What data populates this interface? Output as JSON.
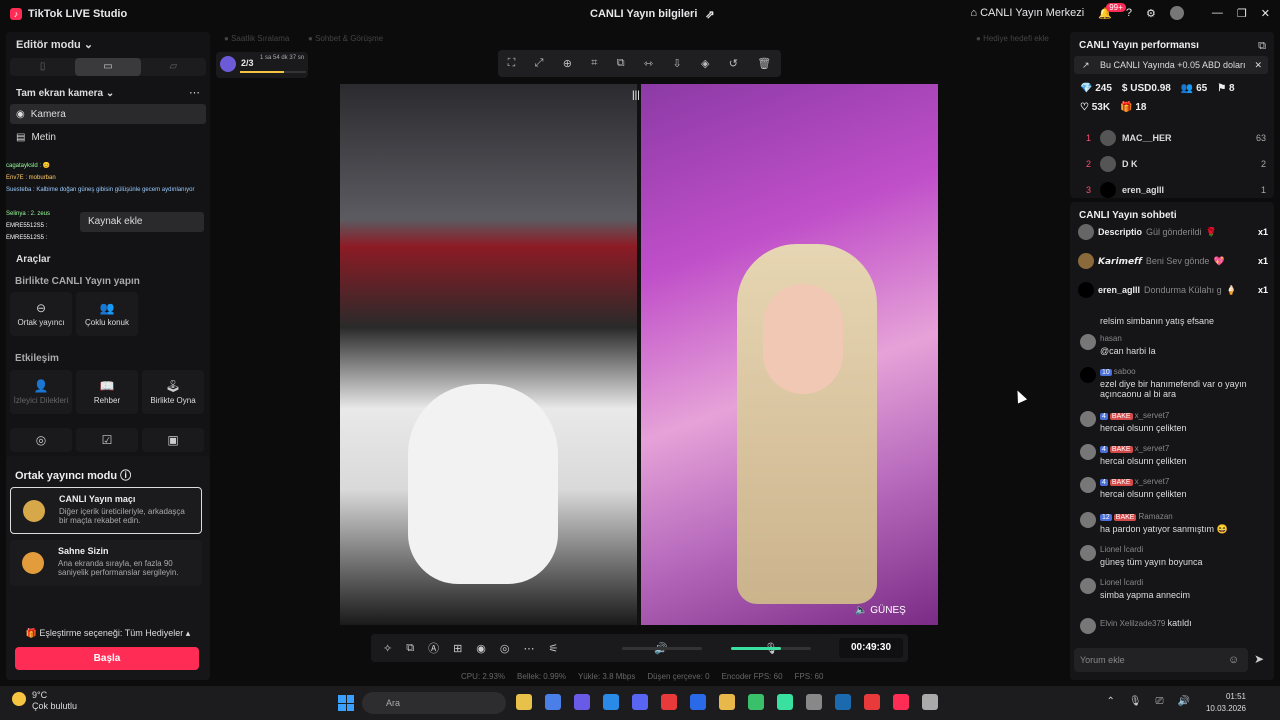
{
  "app": {
    "title": "TikTok LIVE Studio",
    "live_info": "CANLI Yayın bilgileri",
    "live_center": "CANLI Yayın Merkezi",
    "notif_count": "99+"
  },
  "left": {
    "editor_mode": "Editör modu",
    "camera_head": "Tam ekran kamera",
    "sources": [
      {
        "label": "Kamera"
      },
      {
        "label": "Metin"
      }
    ],
    "chat_overlay": [
      "cagatayksld : 😊",
      "Env7E : moburban",
      "Suesteba : Kalbime doğan güneş gibisin gülüşünle gecem aydınlanıyor",
      "Selinya : 2. zeus",
      "EMRE5512S5 :",
      "EMRE5512S5 :"
    ],
    "tooltip": "Kaynak ekle",
    "tools_label": "Araçlar",
    "cohost_head": "Birlikte CANLI Yayın yapın",
    "cohost_btns": [
      {
        "label": "Ortak yayıncı"
      },
      {
        "label": "Çoklu konuk"
      }
    ],
    "interaction_head": "Etkileşim",
    "interaction_btns": [
      {
        "label": "İzleyici Dilekleri"
      },
      {
        "label": "Rehber"
      },
      {
        "label": "Birlikte Oyna"
      }
    ],
    "cohost_mode_head": "Ortak yayıncı modu",
    "cards": [
      {
        "title": "CANLI Yayın maçı",
        "desc": "Diğer içerik üreticileriyle, arkadaşça bir maçta rekabet edin."
      },
      {
        "title": "Sahne Sizin",
        "desc": "Ana ekranda sırayla, en fazla 90 saniyelik performanslar sergileyin."
      }
    ],
    "gift_option": "Eşleştirme seçeneği: Tüm Hediyeler",
    "start": "Başla"
  },
  "canvas": {
    "top_left": "Saatlik Sıralama",
    "top_mid": "Sohbet & Görüşme",
    "top_right": "Hediye hedefi ekle",
    "progress": "2/3",
    "progress_time": "1 sa 54 dk 37 sn",
    "name_tag": "GÜNEŞ"
  },
  "controls": {
    "timer": "00:49:30"
  },
  "stats": {
    "cpu": "CPU: 2.93%",
    "mem": "Bellek: 0.99%",
    "load": "Yükle: 3.8 Mbps",
    "drop": "Düşen çerçeve: 0",
    "enc": "Encoder FPS: 60",
    "fps": "FPS: 60"
  },
  "right": {
    "perf_title": "CANLI Yayın performansı",
    "banner": "Bu CANLI Yayında +0.05 ABD doları",
    "stats": [
      "245",
      "USD0.98",
      "65",
      "8"
    ],
    "stats2": [
      "53K",
      "18"
    ],
    "ranks": [
      {
        "n": "1",
        "name": "MAC__HER",
        "c": "63"
      },
      {
        "n": "2",
        "name": "D K",
        "c": "2"
      },
      {
        "n": "3",
        "name": "eren_aglll",
        "c": "1"
      }
    ],
    "chat_title": "CANLI Yayın sohbeti",
    "gifts": [
      {
        "user": "Descriptio",
        "gift": "Gül gönderildi",
        "x": "x1"
      },
      {
        "user": "𝙆𝙖𝙧𝙞𝙢𝙚𝙛𝙛",
        "gift": "Beni Sev gönde",
        "x": "x1"
      },
      {
        "user": "eren_aglll",
        "gift": "Dondurma Külahı g",
        "x": "x1"
      }
    ],
    "messages": [
      {
        "u": "",
        "t": "relsim simbanın yatış efsane"
      },
      {
        "u": "hasan",
        "t": "@can harbi la"
      },
      {
        "lvl": "10",
        "u": "saboo",
        "t": "ezel diye bir hanımefendi var o yayın açıncaonu al bi ara"
      },
      {
        "lvl": "4",
        "fan": "BAKE",
        "u": "x_servet7",
        "t": "hercai olsunn çelikten"
      },
      {
        "lvl": "4",
        "fan": "BAKE",
        "u": "x_servet7",
        "t": "hercai olsunn çelikten"
      },
      {
        "lvl": "4",
        "fan": "BAKE",
        "u": "x_servet7",
        "t": "hercai olsunn çelikten"
      },
      {
        "lvl": "12",
        "fan": "BAKE",
        "u": "Ramazan",
        "t": "ha pardon yatıyor sanmıştım 😆"
      },
      {
        "u": "Lionel İcardi",
        "t": "güneş tüm yayın boyunca"
      },
      {
        "u": "Lionel İcardi",
        "t": "simba yapma annecim"
      },
      {
        "u": "Elvin Xelilzade379",
        "t": "katıldı"
      }
    ],
    "comment_placeholder": "Yorum ekle"
  },
  "taskbar": {
    "temp": "9°C",
    "weather": "Çok bulutlu",
    "search": "Ara",
    "time": "01:51",
    "date": "10.03.2026"
  }
}
